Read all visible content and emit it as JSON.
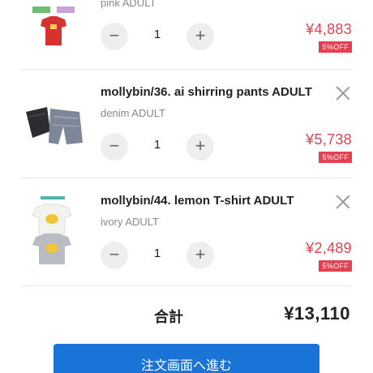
{
  "items": [
    {
      "name": "",
      "variant": "pink ADULT",
      "qty": "1",
      "price": "¥4,883",
      "discount": "5%OFF",
      "thumb_icon": "tshirt-red-icon"
    },
    {
      "name": "mollybin/36. ai shirring pants ADULT",
      "variant": "denim ADULT",
      "qty": "1",
      "price": "¥5,738",
      "discount": "5%OFF",
      "thumb_icon": "pants-icon"
    },
    {
      "name": "mollybin/44. lemon T-shirt ADULT",
      "variant": "ivory ADULT",
      "qty": "1",
      "price": "¥2,489",
      "discount": "5%OFF",
      "thumb_icon": "tshirt-lemon-icon"
    }
  ],
  "stepper": {
    "minus": "−",
    "plus": "+"
  },
  "summary": {
    "total_label": "合計",
    "total_value": "¥13,110"
  },
  "checkout": {
    "label": "注文画面へ進む"
  },
  "colors": {
    "price": "#e0434f",
    "accent": "#1a73d6"
  }
}
